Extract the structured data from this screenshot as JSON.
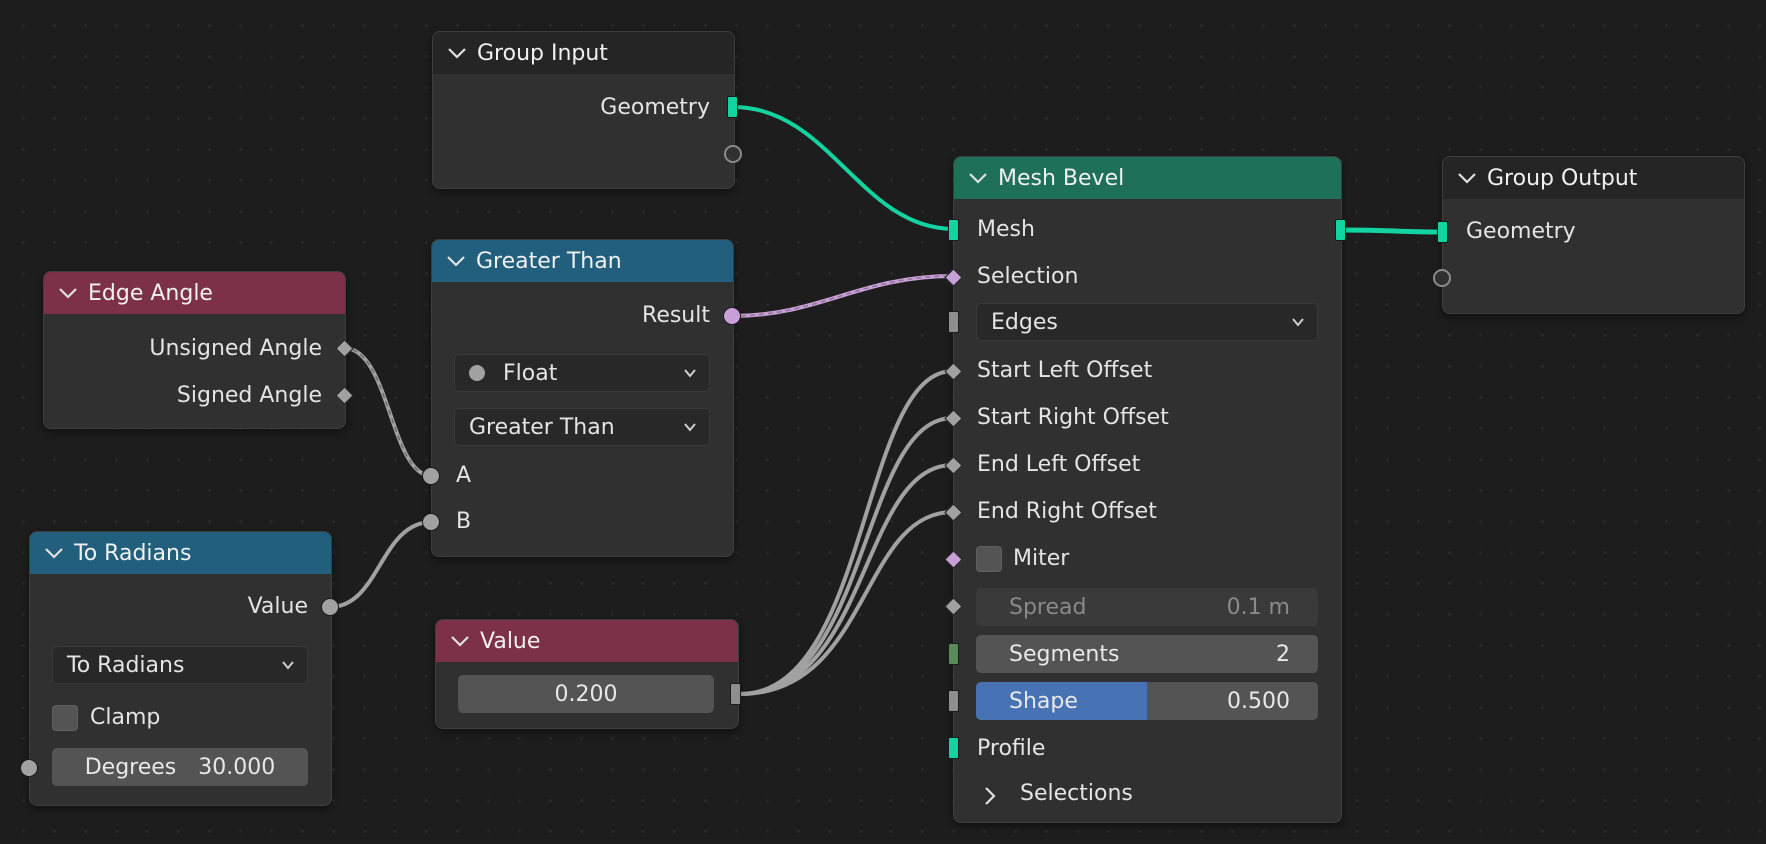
{
  "nodes": {
    "group_input": {
      "title": "Group Input",
      "geometry": "Geometry"
    },
    "greater_than": {
      "title": "Greater Than",
      "result": "Result",
      "data_type": "Float",
      "operation": "Greater Than",
      "a": "A",
      "b": "B"
    },
    "edge_angle": {
      "title": "Edge Angle",
      "unsigned": "Unsigned Angle",
      "signed": "Signed Angle"
    },
    "to_radians": {
      "title": "To Radians",
      "value": "Value",
      "mode": "To Radians",
      "clamp": "Clamp",
      "degrees_label": "Degrees",
      "degrees_value": "30.000"
    },
    "value": {
      "title": "Value",
      "value": "0.200"
    },
    "mesh_bevel": {
      "title": "Mesh Bevel",
      "mesh": "Mesh",
      "selection": "Selection",
      "domain": "Edges",
      "start_left": "Start Left Offset",
      "start_right": "Start Right Offset",
      "end_left": "End Left Offset",
      "end_right": "End Right Offset",
      "miter": "Miter",
      "spread_label": "Spread",
      "spread_value": "0.1 m",
      "segments_label": "Segments",
      "segments_value": "2",
      "shape_label": "Shape",
      "shape_value": "0.500",
      "shape_fraction": 0.5,
      "profile": "Profile",
      "selections": "Selections"
    },
    "group_output": {
      "title": "Group Output",
      "geometry": "Geometry"
    }
  },
  "colors": {
    "geometry_wire": "#13d3a0",
    "float_wire": "#a1a1a1",
    "bool_wire": "#c8a0d8",
    "header_green": "#1e7057",
    "header_blue": "#215f7d",
    "header_red": "#7c3149",
    "shape_fill": "#4772b3"
  }
}
